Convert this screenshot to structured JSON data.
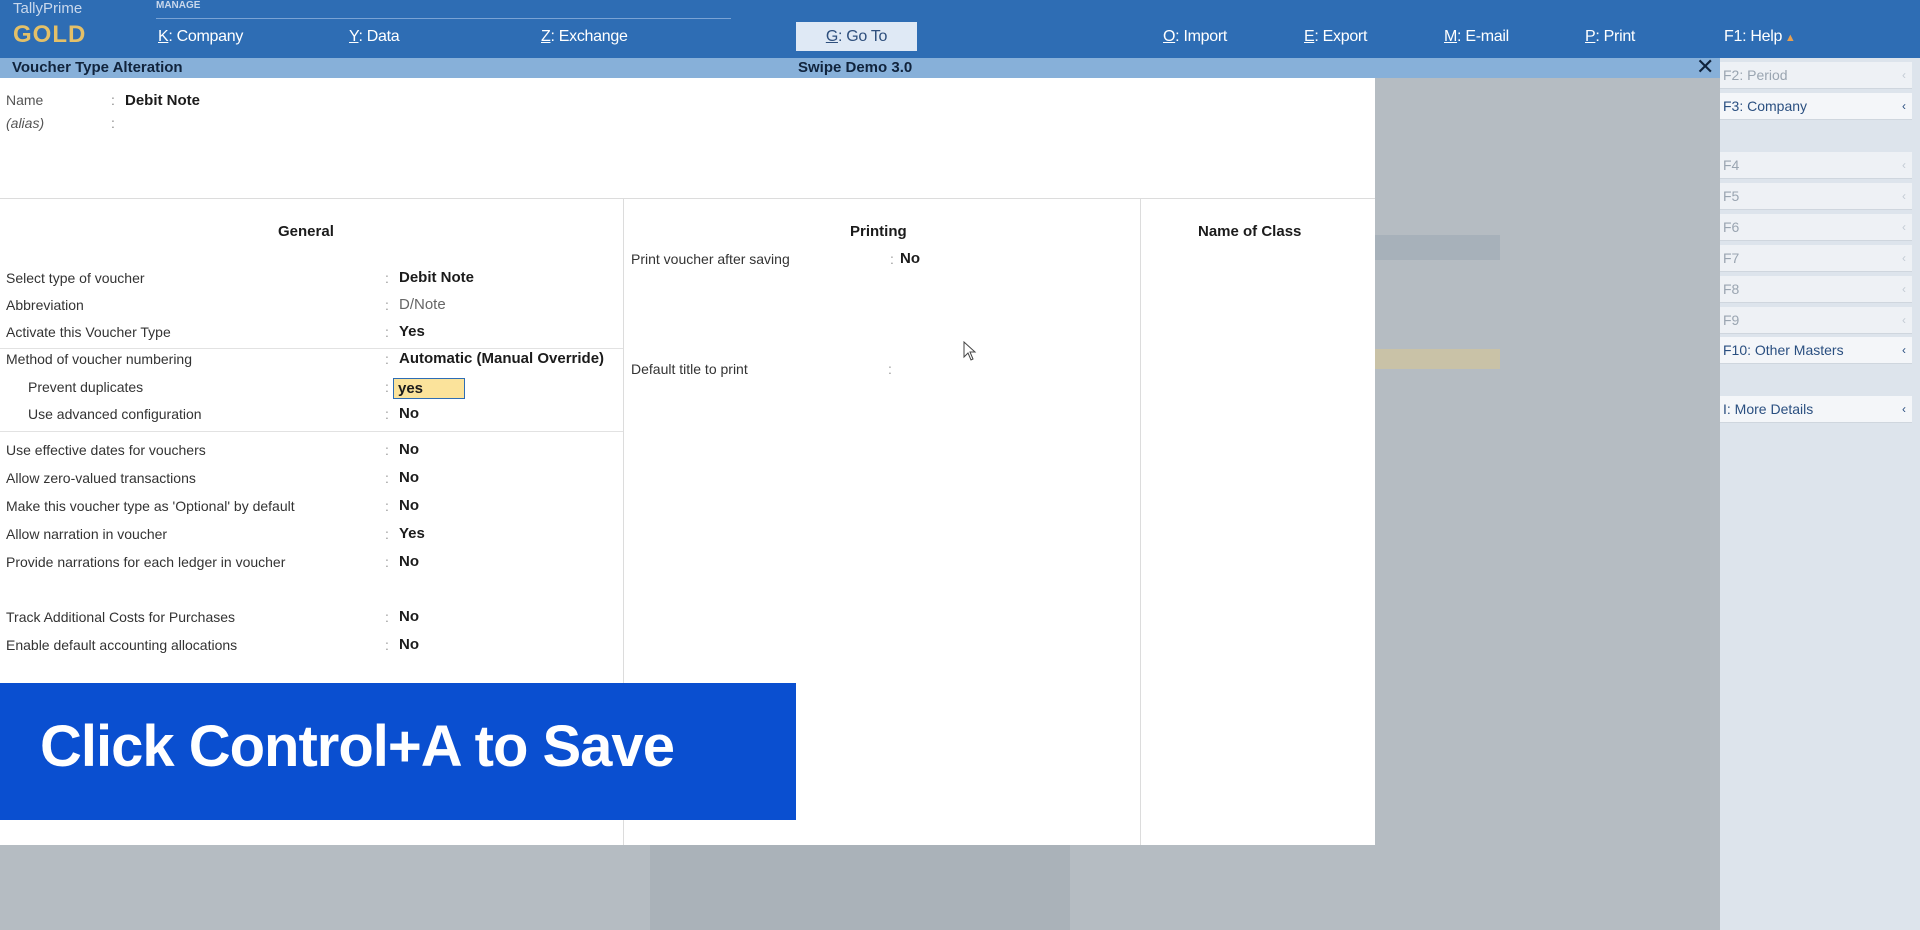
{
  "app": {
    "brand": "TallyPrime",
    "edition": "GOLD",
    "manage_label": "MANAGE"
  },
  "menu": [
    {
      "key": "K",
      "label": ": Company"
    },
    {
      "key": "Y",
      "label": ": Data"
    },
    {
      "key": "Z",
      "label": ": Exchange"
    },
    {
      "key": "G",
      "label": ": Go To"
    },
    {
      "key": "O",
      "label": ": Import"
    },
    {
      "key": "E",
      "label": ": Export"
    },
    {
      "key": "M",
      "label": ": E-mail"
    },
    {
      "key": "P",
      "label": ": Print"
    },
    {
      "key": "F1",
      "label": ": Help"
    }
  ],
  "window": {
    "title": "Voucher Type Alteration",
    "company": "Swipe Demo 3.0",
    "close_icon": "close-icon"
  },
  "header": {
    "name_label": "Name",
    "name_value": "Debit Note",
    "alias_label": "(alias)",
    "colon": ":"
  },
  "sections": {
    "general": "General",
    "printing": "Printing",
    "class": "Name of Class"
  },
  "general": [
    {
      "label": "Select type of voucher",
      "value": "Debit Note"
    },
    {
      "label": "Abbreviation",
      "value": "D/Note"
    },
    {
      "label": "Activate this Voucher Type",
      "value": "Yes"
    },
    {
      "label": "Method of voucher numbering",
      "value": "Automatic (Manual Override)"
    },
    {
      "label": "Prevent duplicates",
      "value": "yes"
    },
    {
      "label": "Use advanced configuration",
      "value": "No"
    },
    {
      "label": "Use effective dates for vouchers",
      "value": "No"
    },
    {
      "label": "Allow zero-valued transactions",
      "value": "No"
    },
    {
      "label": "Make this voucher type as 'Optional' by default",
      "value": "No"
    },
    {
      "label": "Allow narration in voucher",
      "value": "Yes"
    },
    {
      "label": "Provide narrations for each ledger in voucher",
      "value": "No"
    },
    {
      "label": "Track Additional Costs for Purchases",
      "value": "No"
    },
    {
      "label": "Enable default accounting allocations",
      "value": "No"
    }
  ],
  "printing": [
    {
      "label": "Print voucher after saving",
      "value": "No"
    },
    {
      "label": "Default title to print",
      "value": ""
    }
  ],
  "banner": {
    "text": "Click Control+A to Save"
  },
  "rightbar": [
    {
      "label": "F2: Period",
      "active": false
    },
    {
      "label": "F3: Company",
      "active": true
    },
    {
      "label": "F4",
      "active": false
    },
    {
      "label": "F5",
      "active": false
    },
    {
      "label": "F6",
      "active": false
    },
    {
      "label": "F7",
      "active": false
    },
    {
      "label": "F8",
      "active": false
    },
    {
      "label": "F9",
      "active": false
    },
    {
      "label": "F10: Other Masters",
      "active": true
    },
    {
      "label": "I: More Details",
      "active": true
    }
  ],
  "colors": {
    "topbar": "#2e6db4",
    "titlebar": "#87b0d9",
    "banner": "#0a4fd0",
    "input_highlight": "#fbe39b"
  }
}
